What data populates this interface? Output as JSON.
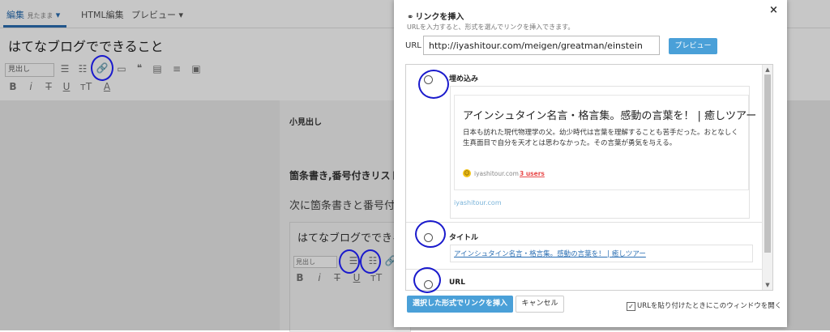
{
  "editor": {
    "tabs": [
      {
        "label": "編集",
        "extra": "見たまま",
        "caret": "▾"
      },
      {
        "label": "HTML編集"
      },
      {
        "label": "プレビュー",
        "caret": "▾"
      }
    ],
    "blog_title": "はてなブログでできること",
    "toolbar_select": "見出し",
    "heading_small": "小見出し",
    "heading_list": "箇条書き,番号付きリスト",
    "paragraph": "次に箇条書きと番号付き",
    "inner_title": "はてなブログでできる",
    "inner_select": "見出し"
  },
  "dialog": {
    "title": "リンクを挿入",
    "subtitle": "URLを入力すると、形式を選んでリンクを挿入できます。",
    "close": "×",
    "url_label": "URL",
    "url_value": "http://iyashitour.com/meigen/greatman/einstein",
    "preview_button": "プレビュー",
    "options": {
      "embed_label": "埋め込み",
      "title_label": "タイトル",
      "url_label": "URL"
    },
    "card": {
      "title": "アインシュタイン名言・格言集。感動の言葉を！ | 癒しツアー",
      "description": "日本も訪れた現代物理学の父。幼少時代は言葉を理解することも苦手だった。おとなしく生真面目で自分を天才とは思わなかった。その言葉が勇気を与える。",
      "site": "iyashitour.com",
      "users": "3 users",
      "footer": "iyashitour.com"
    },
    "title_link": "アインシュタイン名言・格言集。感動の言葉を！ | 癒しツアー",
    "insert_button": "選択した形式でリンクを挿入",
    "cancel_button": "キャンセル",
    "checkbox_label": "URLを貼り付けたときにこのウィンドウを開く",
    "checkbox_checked": true
  },
  "colors": {
    "accent": "#4aa0d8",
    "link": "#2b6fb3",
    "annotation": "#1a1acc"
  }
}
